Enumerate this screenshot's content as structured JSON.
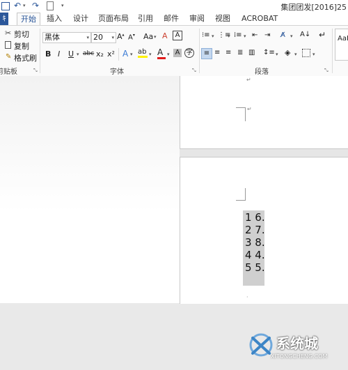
{
  "window": {
    "title": "集团团发[2016]25"
  },
  "tabs": [
    "开始",
    "插入",
    "设计",
    "页面布局",
    "引用",
    "邮件",
    "审阅",
    "视图",
    "ACROBAT"
  ],
  "file_tab_fragment": "ｷ",
  "clipboard": {
    "cut": "剪切",
    "copy": "复制",
    "format_painter": "格式刷",
    "group_label": "剪贴板"
  },
  "font": {
    "name": "黑体",
    "size": "20",
    "group_label": "字体",
    "change_case": "Aa",
    "bold": "B",
    "italic": "I",
    "underline": "U",
    "strike": "abc",
    "subscript": "x₂",
    "superscript": "x²"
  },
  "paragraph": {
    "group_label": "段落"
  },
  "styles": {
    "sample": "AaB"
  },
  "document": {
    "lines": [
      "1  6.",
      "2  7.",
      "3  8.",
      "4  4.",
      "5  5."
    ]
  },
  "watermark": {
    "brand": "系统城",
    "url": "XITONGCHENG.COM"
  },
  "colors": {
    "accent": "#2b579a",
    "font_red": "#e01b1b",
    "highlight": "#fff200",
    "selection": "#cfcfcf"
  }
}
